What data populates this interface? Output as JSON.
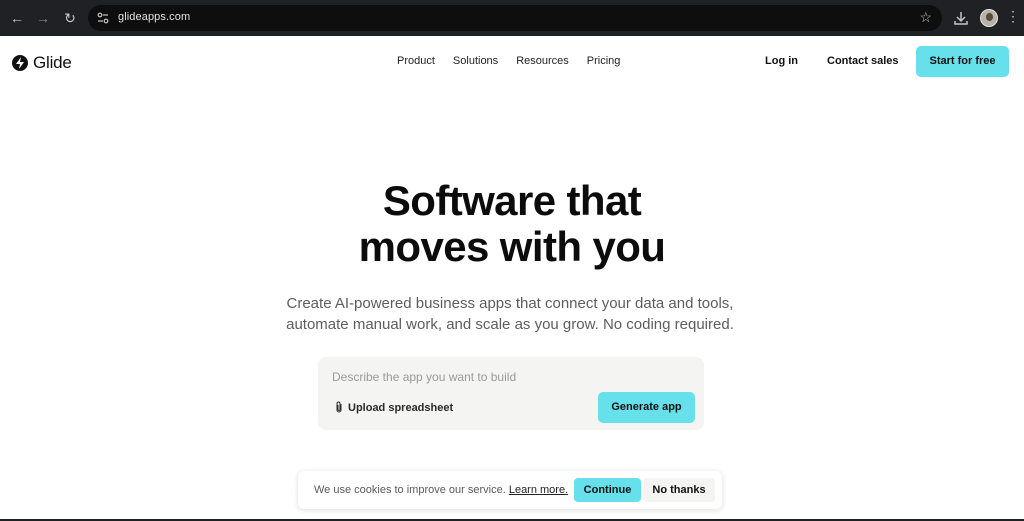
{
  "browser": {
    "url": "glideapps.com"
  },
  "header": {
    "brand": "Glide",
    "nav": [
      "Product",
      "Solutions",
      "Resources",
      "Pricing"
    ],
    "login": "Log in",
    "contact_sales": "Contact sales",
    "cta": "Start for free"
  },
  "hero": {
    "title_line1": "Software that",
    "title_line2": "moves with you",
    "subtitle_line1": "Create AI-powered business apps that connect your data and tools,",
    "subtitle_line2": "automate manual work, and scale as you grow. No coding required."
  },
  "prompt": {
    "placeholder": "Describe the app you want to build",
    "upload_label": "Upload spreadsheet",
    "generate_label": "Generate app"
  },
  "cookie": {
    "message": "We use cookies to improve our service.",
    "learn_more": "Learn more.",
    "continue": "Continue",
    "no_thanks": "No thanks"
  },
  "colors": {
    "accent": "#66e0ea",
    "chrome": "#202124",
    "card": "#f4f4f2"
  }
}
